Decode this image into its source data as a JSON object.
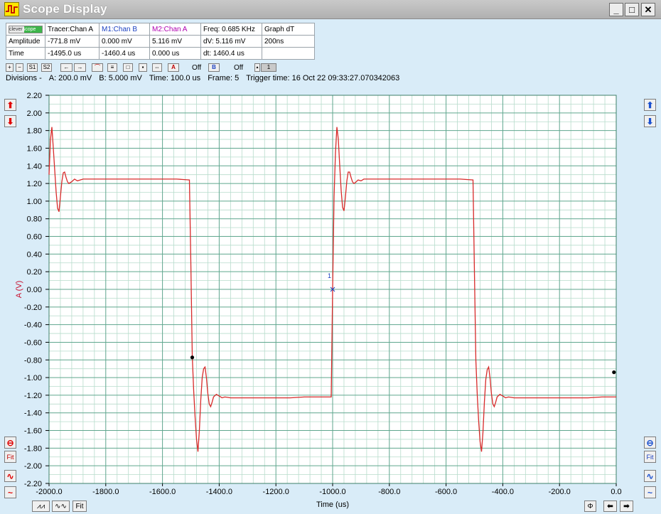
{
  "window": {
    "title": "Scope Display",
    "minimize": "_",
    "maximize": "□",
    "close": "✕"
  },
  "info_table": {
    "logo_left": "clever",
    "logo_right": "scope",
    "headers": [
      "Tracer:Chan A",
      "M1:Chan B",
      "M2:Chan A",
      "Freq: 0.685 KHz",
      "Graph dT"
    ],
    "amplitude_row": [
      "Amplitude",
      "-771.8 mV",
      "0.000 mV",
      "5.116 mV",
      "dV: 5.116 mV",
      "200ns"
    ],
    "time_row": [
      "Time",
      "-1495.0 us",
      "-1460.4 us",
      "0.000 us",
      "dt:  1460.4 us",
      ""
    ]
  },
  "toolbar": {
    "buttons": [
      "+",
      "−",
      "S1",
      "S2",
      "←",
      "→",
      "⌒",
      "≡",
      "□",
      "▪",
      "⇔",
      "A",
      "B"
    ],
    "off_a": "Off",
    "off_b": "Off",
    "frame_spin": "1"
  },
  "divisions": {
    "label": "Divisions -",
    "a": "A: 200.0 mV",
    "b": "B: 5.000 mV",
    "time": "Time: 100.0 us",
    "frame": "Frame: 5",
    "trigger": "Trigger time: 16 Oct 22 09:33:27.070342063"
  },
  "side_controls": {
    "fit_left": "Fit",
    "fit_right": "Fit",
    "fit_bottom": "Fit"
  },
  "colors": {
    "trace": "#d82a2a",
    "grid_major": "#5fa68e",
    "grid_minor": "#b7dccc",
    "axis_text": "#000000",
    "ylabel": "#c8102e",
    "marker": "#1a3fc0"
  },
  "chart_data": {
    "type": "line",
    "xlabel": "Time (us)",
    "ylabel": "A (V)",
    "xlim": [
      -2000,
      0
    ],
    "ylim": [
      -2.2,
      2.2
    ],
    "x_ticks": [
      "-2000.0",
      "-1800.0",
      "-1600.0",
      "-1400.0",
      "-1200.0",
      "-1000.0",
      "-800.0",
      "-600.0",
      "-400.0",
      "-200.0",
      "0.0"
    ],
    "y_ticks": [
      "2.20",
      "2.00",
      "1.80",
      "1.60",
      "1.40",
      "1.20",
      "1.00",
      "0.80",
      "0.60",
      "0.40",
      "0.20",
      "0.00",
      "-0.20",
      "-0.40",
      "-0.60",
      "-0.80",
      "-1.00",
      "-1.20",
      "-1.40",
      "-1.60",
      "-1.80",
      "-2.00",
      "-2.20"
    ],
    "series": [
      {
        "x": [
          -2000,
          -1995,
          -1990,
          -1985,
          -1980,
          -1975,
          -1970,
          -1965,
          -1960,
          -1955,
          -1950,
          -1945,
          -1940,
          -1935,
          -1930,
          -1920,
          -1910,
          -1900,
          -1880,
          -1850,
          -1800,
          -1750,
          -1700,
          -1650,
          -1600,
          -1550,
          -1505,
          -1500,
          -1495,
          -1490,
          -1485,
          -1480,
          -1475,
          -1470,
          -1465,
          -1460,
          -1455,
          -1450,
          -1445,
          -1440,
          -1435,
          -1430,
          -1425,
          -1420,
          -1410,
          -1400,
          -1390,
          -1380,
          -1360,
          -1330,
          -1300,
          -1250,
          -1200,
          -1150,
          -1100,
          -1050,
          -1005,
          -1000,
          -995,
          -990,
          -985,
          -980,
          -975,
          -970,
          -965,
          -960,
          -955,
          -950,
          -945,
          -940,
          -935,
          -930,
          -925,
          -920,
          -910,
          -900,
          -890,
          -880,
          -860,
          -830,
          -800,
          -750,
          -700,
          -650,
          -600,
          -550,
          -505,
          -500,
          -495,
          -490,
          -485,
          -480,
          -475,
          -470,
          -465,
          -460,
          -455,
          -450,
          -445,
          -440,
          -435,
          -430,
          -425,
          -420,
          -410,
          -400,
          -390,
          -380,
          -360,
          -330,
          -300,
          -250,
          -200,
          -150,
          -100,
          -50,
          0
        ],
        "y": [
          1.3,
          1.7,
          1.84,
          1.6,
          1.35,
          1.1,
          0.92,
          0.88,
          1.05,
          1.22,
          1.32,
          1.33,
          1.27,
          1.22,
          1.2,
          1.22,
          1.25,
          1.23,
          1.25,
          1.25,
          1.25,
          1.25,
          1.25,
          1.25,
          1.25,
          1.25,
          1.24,
          0.3,
          -0.75,
          -1.15,
          -1.45,
          -1.7,
          -1.84,
          -1.6,
          -1.25,
          -1.0,
          -0.9,
          -0.88,
          -1.0,
          -1.18,
          -1.3,
          -1.33,
          -1.28,
          -1.22,
          -1.19,
          -1.21,
          -1.23,
          -1.22,
          -1.23,
          -1.23,
          -1.23,
          -1.23,
          -1.23,
          -1.23,
          -1.22,
          -1.22,
          -1.22,
          0.0,
          1.05,
          1.55,
          1.84,
          1.7,
          1.4,
          1.12,
          0.93,
          0.89,
          1.05,
          1.23,
          1.33,
          1.33,
          1.27,
          1.22,
          1.2,
          1.21,
          1.24,
          1.23,
          1.25,
          1.25,
          1.25,
          1.25,
          1.25,
          1.25,
          1.25,
          1.25,
          1.25,
          1.25,
          1.24,
          0.2,
          -0.8,
          -1.2,
          -1.5,
          -1.73,
          -1.84,
          -1.62,
          -1.28,
          -1.02,
          -0.91,
          -0.88,
          -1.0,
          -1.18,
          -1.3,
          -1.33,
          -1.28,
          -1.22,
          -1.19,
          -1.21,
          -1.23,
          -1.22,
          -1.23,
          -1.23,
          -1.23,
          -1.23,
          -1.23,
          -1.23,
          -1.23,
          -1.22,
          -1.22
        ]
      }
    ],
    "markers": [
      {
        "label": "",
        "x": -1495.0,
        "y": -0.7718,
        "style": "dot"
      },
      {
        "label": "1",
        "x": -1000.0,
        "y": 0.0,
        "style": "cross"
      },
      {
        "label": "",
        "x": -8,
        "y": -0.94,
        "style": "dot"
      }
    ]
  },
  "bottom_controls": {
    "fit": "Fit"
  }
}
